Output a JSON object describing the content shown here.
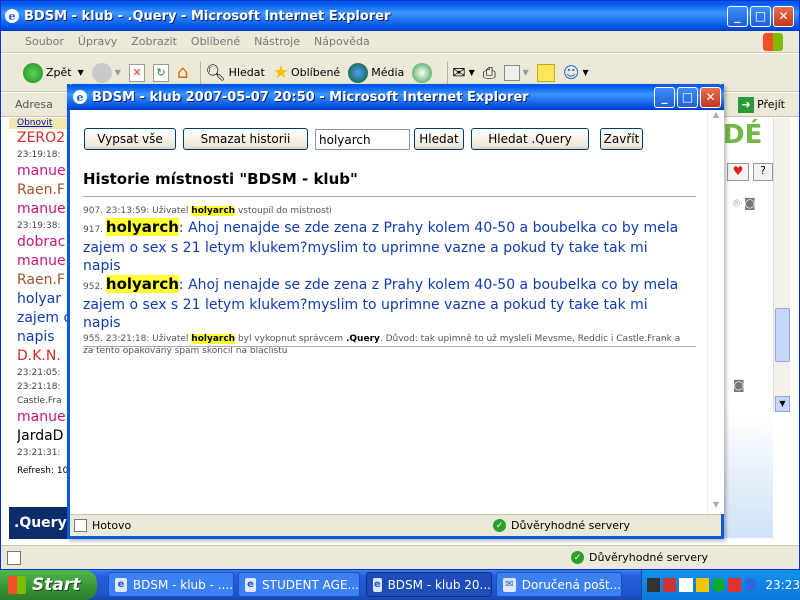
{
  "bg_window": {
    "title": "BDSM - klub - .Query - Microsoft Internet Explorer",
    "menu": [
      "Soubor",
      "Úpravy",
      "Zobrazit",
      "Oblíbené",
      "Nástroje",
      "Nápověda"
    ],
    "toolbar": {
      "back": "Zpět",
      "search": "Hledat",
      "favorites": "Oblíbené",
      "media": "Média"
    },
    "address_label": "Adresa",
    "go_label": "Přejít",
    "obnovit": "Obnovit",
    "chat_lines": [
      {
        "text": "ZERO2",
        "color": "#d22a2a"
      },
      {
        "text": "23:19:18:",
        "color": "#444",
        "small": true
      },
      {
        "text": "manue",
        "color": "#c71585"
      },
      {
        "text": "Raen.F",
        "color": "#a0522d"
      },
      {
        "text": "manue",
        "color": "#c71585"
      },
      {
        "text": "23:19:38:",
        "color": "#444",
        "small": true
      },
      {
        "text": "dobrac",
        "color": "#c71585"
      },
      {
        "text": "manue",
        "color": "#c71585"
      },
      {
        "text": "Raen.F",
        "color": "#a0522d"
      },
      {
        "text": "holyar",
        "color": "#113bb3"
      },
      {
        "text": "zajem o",
        "color": "#113bb3"
      },
      {
        "text": "napis",
        "color": "#113bb3"
      },
      {
        "text": "D.K.N.",
        "color": "#d22a2a"
      },
      {
        "text": "23:21:05:",
        "color": "#444",
        "small": true
      },
      {
        "text": "23:21:18:",
        "color": "#444",
        "small": true
      },
      {
        "text": "Castle.Fra",
        "color": "#444",
        "small": true
      },
      {
        "text": "manue",
        "color": "#c71585"
      },
      {
        "text": "JardaD",
        "color": "#000"
      },
      {
        "text": "23:21:31:",
        "color": "#444",
        "small": true
      }
    ],
    "refresh": "Refresh: 10",
    "footer_brand": ".Query",
    "status_zone": "Důvěryhodné servery",
    "right_logo": "DÉ"
  },
  "popup": {
    "title": "BDSM - klub 2007-05-07 20:50 - Microsoft Internet Explorer",
    "buttons": {
      "show_all": "Vypsat vše",
      "clear_history": "Smazat historii",
      "search": "Hledat",
      "search_query": "Hledat .Query",
      "close": "Zavřít"
    },
    "search_value": "holyarch",
    "heading": "Historie místnosti \"BDSM - klub\"",
    "messages": [
      {
        "num": "907. 23:13:59: Uživatel ",
        "nick": "holyarch",
        "rest": " vstoupil do místnosti"
      },
      {
        "num": "917. ",
        "nick": "holyarch",
        "text": ": Ahoj nenajde se zde zena z Prahy kolem 40-50 a boubelka co by mela zajem o sex s 21 letym klukem?myslim to uprimne vazne a pokud ty take tak mi napis"
      },
      {
        "num": "952. ",
        "nick": "holyarch",
        "text": ": Ahoj nenajde se zde zena z Prahy kolem 40-50 a boubelka co by mela zajem o sex s 21 letym klukem?myslim to uprimne vazne a pokud ty take tak mi napis"
      },
      {
        "num": "955. 23:21:18: Uživatel ",
        "nick": "holyarch",
        "mid": " byl vykopnut správcem ",
        "bold2": ".Query",
        "rest": ". Důvod: tak upimně to už mysleli Mevsme, Reddic i Castle.Frank a za tento opakovaný spam skončil na blaclistu"
      }
    ],
    "status": "Hotovo",
    "status_zone": "Důvěryhodné servery"
  },
  "taskbar": {
    "start": "Start",
    "tasks": [
      "BDSM - klub - ....",
      "STUDENT AGE...",
      "BDSM - klub 20...",
      "Doručená pošt..."
    ],
    "clock": "23:23"
  }
}
